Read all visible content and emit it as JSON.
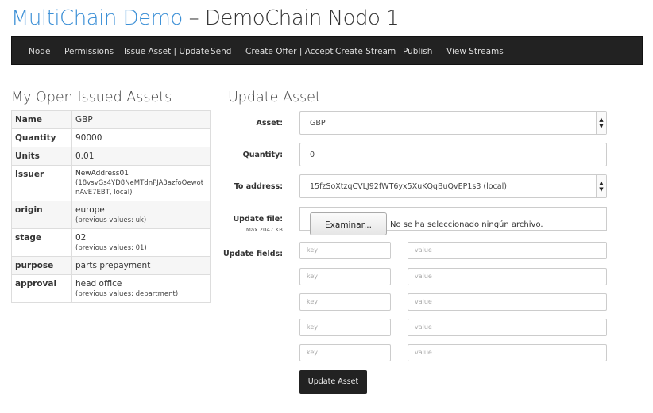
{
  "header": {
    "brand": "MultiChain Demo",
    "rest": "– DemoChain Nodo 1"
  },
  "nav": [
    "Node",
    "Permissions",
    "Issue Asset | Update",
    "Send",
    "Create Offer | Accept",
    "Create Stream",
    "Publish",
    "View Streams"
  ],
  "left": {
    "heading": "My Open Issued Assets",
    "rows": [
      {
        "key": "Name",
        "value": "GBP",
        "note": ""
      },
      {
        "key": "Quantity",
        "value": "90000",
        "note": ""
      },
      {
        "key": "Units",
        "value": "0.01",
        "note": ""
      },
      {
        "key": "Issuer",
        "value": "NewAddress01",
        "note": "(18vsvGs4YD8NeMTdnPJA3azfoQewotnAvE7EBT, local)"
      },
      {
        "key": "origin",
        "value": "europe",
        "note": "(previous values: uk)"
      },
      {
        "key": "stage",
        "value": "02",
        "note": "(previous values: 01)"
      },
      {
        "key": "purpose",
        "value": "parts prepayment",
        "note": ""
      },
      {
        "key": "approval",
        "value": "head office",
        "note": "(previous values: department)"
      }
    ]
  },
  "form": {
    "heading": "Update Asset",
    "asset_label": "Asset:",
    "asset_value": "GBP",
    "quantity_label": "Quantity:",
    "quantity_value": "0",
    "to_label": "To address:",
    "to_value": "15fzSoXtzqCVLJ92fWT6yx5XuKQqBuQvEP1s3 (local)",
    "file_label": "Update file:",
    "file_sub": "Max 2047 KB",
    "file_button": "Examinar...",
    "file_status": "No se ha seleccionado ningún archivo.",
    "fields_label": "Update fields:",
    "key_placeholder": "key",
    "value_placeholder": "value",
    "submit": "Update Asset"
  },
  "colors": {
    "brand": "#3b8fd6",
    "navbar": "#222222",
    "button": "#222222"
  }
}
